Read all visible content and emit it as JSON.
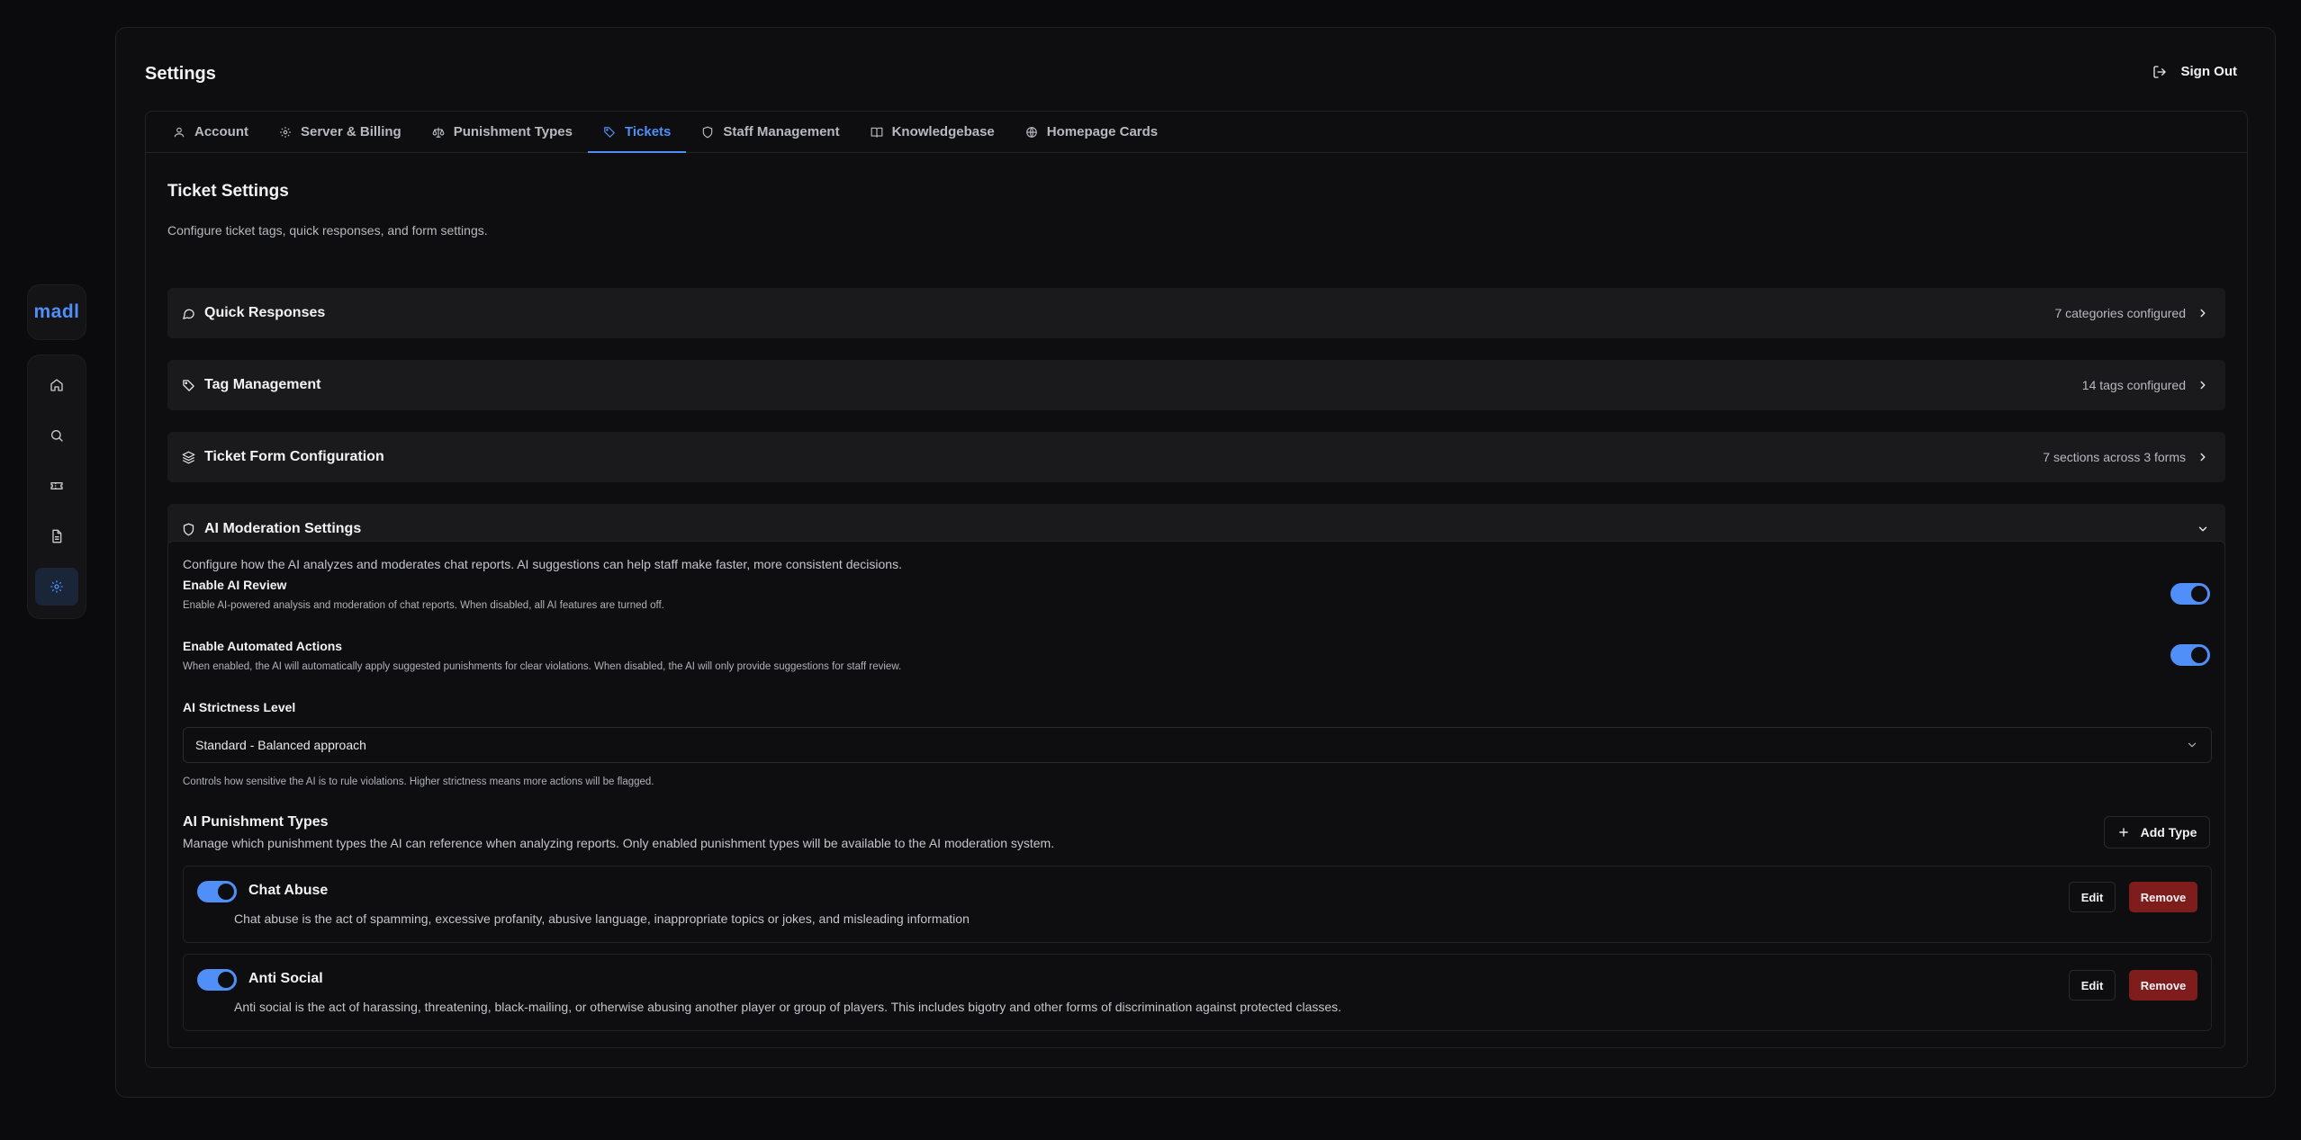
{
  "app": {
    "logo": "madl",
    "accent": "#4f8ff7",
    "danger": "#7f1d1d"
  },
  "header": {
    "title": "Settings",
    "sign_out_label": "Sign Out"
  },
  "tabs": [
    {
      "label": "Account",
      "icon": "user-icon"
    },
    {
      "label": "Server & Billing",
      "icon": "gear-icon"
    },
    {
      "label": "Punishment Types",
      "icon": "scale-icon"
    },
    {
      "label": "Tickets",
      "icon": "tag-icon",
      "active": true
    },
    {
      "label": "Staff Management",
      "icon": "shield-icon"
    },
    {
      "label": "Knowledgebase",
      "icon": "book-icon"
    },
    {
      "label": "Homepage Cards",
      "icon": "globe-icon"
    }
  ],
  "ticket_settings": {
    "title": "Ticket Settings",
    "description": "Configure ticket tags, quick responses, and form settings."
  },
  "sections": [
    {
      "title": "Quick Responses",
      "summary": "7 categories configured",
      "icon": "chat-icon"
    },
    {
      "title": "Tag Management",
      "summary": "14 tags configured",
      "icon": "tag-icon"
    },
    {
      "title": "Ticket Form Configuration",
      "summary": "7 sections across 3 forms",
      "icon": "layers-icon"
    },
    {
      "title": "AI Moderation Settings",
      "summary": "",
      "icon": "shield-icon",
      "expanded": true
    }
  ],
  "ai": {
    "intro": "Configure how the AI analyzes and moderates chat reports. AI suggestions can help staff make faster, more consistent decisions.",
    "enable_review": {
      "title": "Enable AI Review",
      "desc": "Enable AI-powered analysis and moderation of chat reports. When disabled, all AI features are turned off.",
      "on": true
    },
    "enable_actions": {
      "title": "Enable Automated Actions",
      "desc": "When enabled, the AI will automatically apply suggested punishments for clear violations. When disabled, the AI will only provide suggestions for staff review.",
      "on": true
    },
    "strictness": {
      "label": "AI Strictness Level",
      "value": "Standard - Balanced approach",
      "hint": "Controls how sensitive the AI is to rule violations. Higher strictness means more actions will be flagged."
    },
    "punishment_types": {
      "title": "AI Punishment Types",
      "desc": "Manage which punishment types the AI can reference when analyzing reports. Only enabled punishment types will be available to the AI moderation system.",
      "add_label": "Add Type",
      "edit_label": "Edit",
      "remove_label": "Remove",
      "items": [
        {
          "name": "Chat Abuse",
          "enabled": true,
          "desc": "Chat abuse is the act of spamming, excessive profanity, abusive language, inappropriate topics or jokes, and misleading information"
        },
        {
          "name": "Anti Social",
          "enabled": true,
          "desc": "Anti social is the act of harassing, threatening, black-mailing, or otherwise abusing another player or group of players. This includes bigotry and other forms of discrimination against protected classes."
        }
      ]
    }
  },
  "rail": [
    {
      "icon": "home-icon"
    },
    {
      "icon": "search-icon"
    },
    {
      "icon": "ticket-icon"
    },
    {
      "icon": "document-icon"
    },
    {
      "icon": "gear-icon",
      "active": true
    }
  ]
}
